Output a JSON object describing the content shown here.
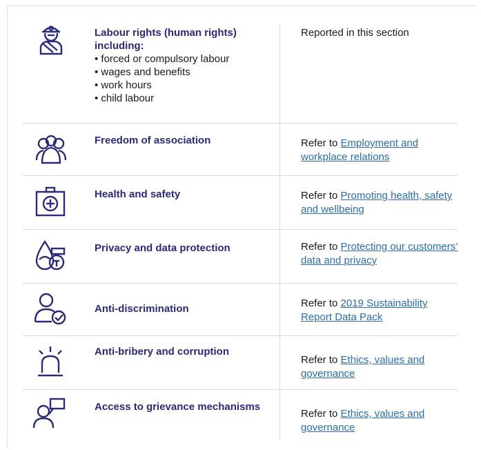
{
  "rows": [
    {
      "icon": "worker-icon",
      "issue": "Labour rights (human rights) including:",
      "bullets": [
        "forced or compulsory labour",
        "wages and benefits",
        "work hours",
        "child labour"
      ],
      "ref_text": "Reported in this section",
      "ref_link": ""
    },
    {
      "icon": "group-people-icon",
      "issue": "Freedom of association",
      "ref_text": "Refer to ",
      "ref_link": "Employment and workplace relations"
    },
    {
      "icon": "first-aid-kit-icon",
      "issue": "Health and safety",
      "ref_text": "Refer to ",
      "ref_link": "Promoting health, safety and wellbeing"
    },
    {
      "icon": "data-privacy-icon",
      "issue": "Privacy and data protection",
      "ref_text": "Refer to ",
      "ref_link": "Protecting our customers’ data and privacy"
    },
    {
      "icon": "person-check-icon",
      "issue": "Anti-discrimination",
      "ref_text": "Refer to ",
      "ref_link": "2019 Sustainability Report Data Pack"
    },
    {
      "icon": "alarm-icon",
      "issue": "Anti-bribery and corruption",
      "ref_text": "Refer to ",
      "ref_link": "Ethics, values and governance"
    },
    {
      "icon": "speech-person-icon",
      "issue": "Access to grievance mechanisms",
      "ref_text": "Refer to ",
      "ref_link": "Ethics, values and governance"
    }
  ],
  "colors": {
    "heading": "#2a2a7c",
    "link": "#2b6cb0",
    "rule": "#d9d9d9"
  }
}
